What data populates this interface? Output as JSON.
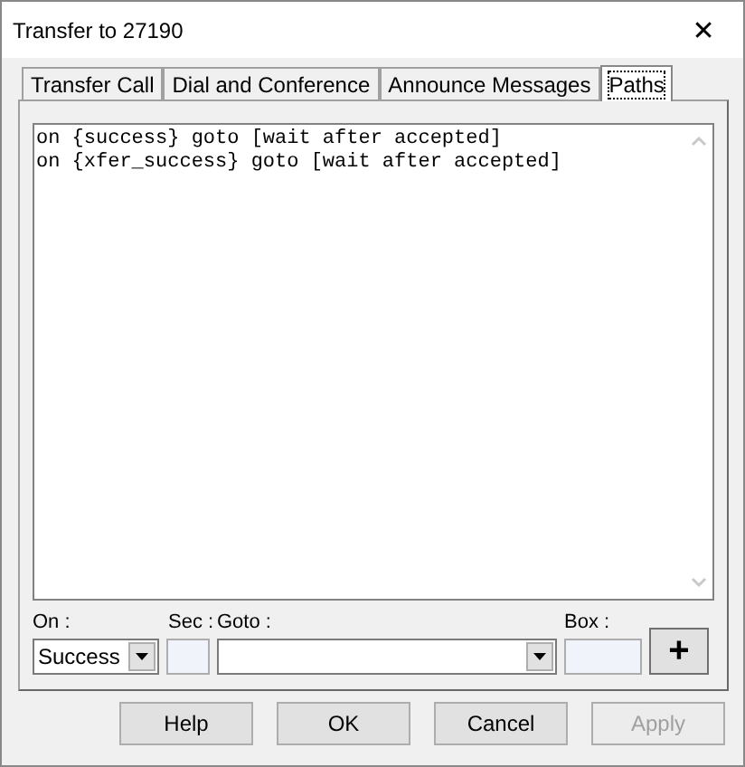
{
  "window": {
    "title": "Transfer to 27190",
    "close": "✕"
  },
  "tabs": [
    {
      "label": "Transfer Call",
      "selected": false
    },
    {
      "label": "Dial and Conference",
      "selected": false
    },
    {
      "label": "Announce Messages",
      "selected": false
    },
    {
      "label": "Paths",
      "selected": true
    }
  ],
  "paths": [
    "on {success} goto [wait after accepted]",
    "on {xfer_success} goto [wait after accepted]"
  ],
  "form": {
    "on_label": "On :",
    "on_value": "Success",
    "sec_label": "Sec :",
    "goto_label": "Goto :",
    "box_label": "Box :",
    "add": "+"
  },
  "buttons": [
    {
      "label": "Help",
      "disabled": false
    },
    {
      "label": "OK",
      "disabled": false
    },
    {
      "label": "Cancel",
      "disabled": false
    },
    {
      "label": "Apply",
      "disabled": true
    }
  ]
}
